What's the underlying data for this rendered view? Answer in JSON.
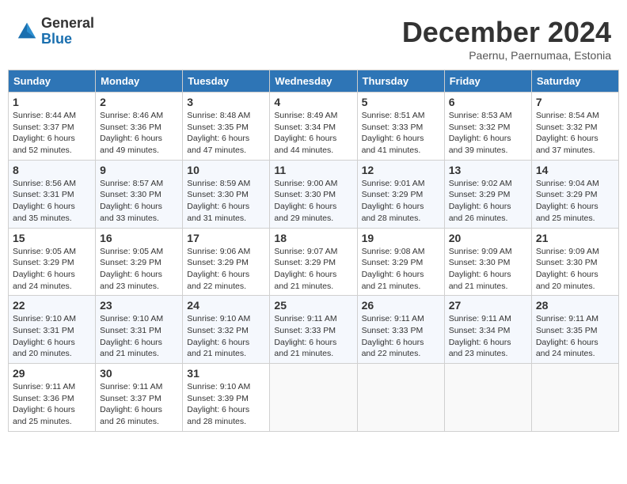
{
  "header": {
    "logo_general": "General",
    "logo_blue": "Blue",
    "month_title": "December 2024",
    "subtitle": "Paernu, Paernumaa, Estonia"
  },
  "weekdays": [
    "Sunday",
    "Monday",
    "Tuesday",
    "Wednesday",
    "Thursday",
    "Friday",
    "Saturday"
  ],
  "weeks": [
    [
      {
        "day": "1",
        "sunrise": "Sunrise: 8:44 AM",
        "sunset": "Sunset: 3:37 PM",
        "daylight": "Daylight: 6 hours and 52 minutes."
      },
      {
        "day": "2",
        "sunrise": "Sunrise: 8:46 AM",
        "sunset": "Sunset: 3:36 PM",
        "daylight": "Daylight: 6 hours and 49 minutes."
      },
      {
        "day": "3",
        "sunrise": "Sunrise: 8:48 AM",
        "sunset": "Sunset: 3:35 PM",
        "daylight": "Daylight: 6 hours and 47 minutes."
      },
      {
        "day": "4",
        "sunrise": "Sunrise: 8:49 AM",
        "sunset": "Sunset: 3:34 PM",
        "daylight": "Daylight: 6 hours and 44 minutes."
      },
      {
        "day": "5",
        "sunrise": "Sunrise: 8:51 AM",
        "sunset": "Sunset: 3:33 PM",
        "daylight": "Daylight: 6 hours and 41 minutes."
      },
      {
        "day": "6",
        "sunrise": "Sunrise: 8:53 AM",
        "sunset": "Sunset: 3:32 PM",
        "daylight": "Daylight: 6 hours and 39 minutes."
      },
      {
        "day": "7",
        "sunrise": "Sunrise: 8:54 AM",
        "sunset": "Sunset: 3:32 PM",
        "daylight": "Daylight: 6 hours and 37 minutes."
      }
    ],
    [
      {
        "day": "8",
        "sunrise": "Sunrise: 8:56 AM",
        "sunset": "Sunset: 3:31 PM",
        "daylight": "Daylight: 6 hours and 35 minutes."
      },
      {
        "day": "9",
        "sunrise": "Sunrise: 8:57 AM",
        "sunset": "Sunset: 3:30 PM",
        "daylight": "Daylight: 6 hours and 33 minutes."
      },
      {
        "day": "10",
        "sunrise": "Sunrise: 8:59 AM",
        "sunset": "Sunset: 3:30 PM",
        "daylight": "Daylight: 6 hours and 31 minutes."
      },
      {
        "day": "11",
        "sunrise": "Sunrise: 9:00 AM",
        "sunset": "Sunset: 3:30 PM",
        "daylight": "Daylight: 6 hours and 29 minutes."
      },
      {
        "day": "12",
        "sunrise": "Sunrise: 9:01 AM",
        "sunset": "Sunset: 3:29 PM",
        "daylight": "Daylight: 6 hours and 28 minutes."
      },
      {
        "day": "13",
        "sunrise": "Sunrise: 9:02 AM",
        "sunset": "Sunset: 3:29 PM",
        "daylight": "Daylight: 6 hours and 26 minutes."
      },
      {
        "day": "14",
        "sunrise": "Sunrise: 9:04 AM",
        "sunset": "Sunset: 3:29 PM",
        "daylight": "Daylight: 6 hours and 25 minutes."
      }
    ],
    [
      {
        "day": "15",
        "sunrise": "Sunrise: 9:05 AM",
        "sunset": "Sunset: 3:29 PM",
        "daylight": "Daylight: 6 hours and 24 minutes."
      },
      {
        "day": "16",
        "sunrise": "Sunrise: 9:05 AM",
        "sunset": "Sunset: 3:29 PM",
        "daylight": "Daylight: 6 hours and 23 minutes."
      },
      {
        "day": "17",
        "sunrise": "Sunrise: 9:06 AM",
        "sunset": "Sunset: 3:29 PM",
        "daylight": "Daylight: 6 hours and 22 minutes."
      },
      {
        "day": "18",
        "sunrise": "Sunrise: 9:07 AM",
        "sunset": "Sunset: 3:29 PM",
        "daylight": "Daylight: 6 hours and 21 minutes."
      },
      {
        "day": "19",
        "sunrise": "Sunrise: 9:08 AM",
        "sunset": "Sunset: 3:29 PM",
        "daylight": "Daylight: 6 hours and 21 minutes."
      },
      {
        "day": "20",
        "sunrise": "Sunrise: 9:09 AM",
        "sunset": "Sunset: 3:30 PM",
        "daylight": "Daylight: 6 hours and 21 minutes."
      },
      {
        "day": "21",
        "sunrise": "Sunrise: 9:09 AM",
        "sunset": "Sunset: 3:30 PM",
        "daylight": "Daylight: 6 hours and 20 minutes."
      }
    ],
    [
      {
        "day": "22",
        "sunrise": "Sunrise: 9:10 AM",
        "sunset": "Sunset: 3:31 PM",
        "daylight": "Daylight: 6 hours and 20 minutes."
      },
      {
        "day": "23",
        "sunrise": "Sunrise: 9:10 AM",
        "sunset": "Sunset: 3:31 PM",
        "daylight": "Daylight: 6 hours and 21 minutes."
      },
      {
        "day": "24",
        "sunrise": "Sunrise: 9:10 AM",
        "sunset": "Sunset: 3:32 PM",
        "daylight": "Daylight: 6 hours and 21 minutes."
      },
      {
        "day": "25",
        "sunrise": "Sunrise: 9:11 AM",
        "sunset": "Sunset: 3:33 PM",
        "daylight": "Daylight: 6 hours and 21 minutes."
      },
      {
        "day": "26",
        "sunrise": "Sunrise: 9:11 AM",
        "sunset": "Sunset: 3:33 PM",
        "daylight": "Daylight: 6 hours and 22 minutes."
      },
      {
        "day": "27",
        "sunrise": "Sunrise: 9:11 AM",
        "sunset": "Sunset: 3:34 PM",
        "daylight": "Daylight: 6 hours and 23 minutes."
      },
      {
        "day": "28",
        "sunrise": "Sunrise: 9:11 AM",
        "sunset": "Sunset: 3:35 PM",
        "daylight": "Daylight: 6 hours and 24 minutes."
      }
    ],
    [
      {
        "day": "29",
        "sunrise": "Sunrise: 9:11 AM",
        "sunset": "Sunset: 3:36 PM",
        "daylight": "Daylight: 6 hours and 25 minutes."
      },
      {
        "day": "30",
        "sunrise": "Sunrise: 9:11 AM",
        "sunset": "Sunset: 3:37 PM",
        "daylight": "Daylight: 6 hours and 26 minutes."
      },
      {
        "day": "31",
        "sunrise": "Sunrise: 9:10 AM",
        "sunset": "Sunset: 3:39 PM",
        "daylight": "Daylight: 6 hours and 28 minutes."
      },
      null,
      null,
      null,
      null
    ]
  ]
}
